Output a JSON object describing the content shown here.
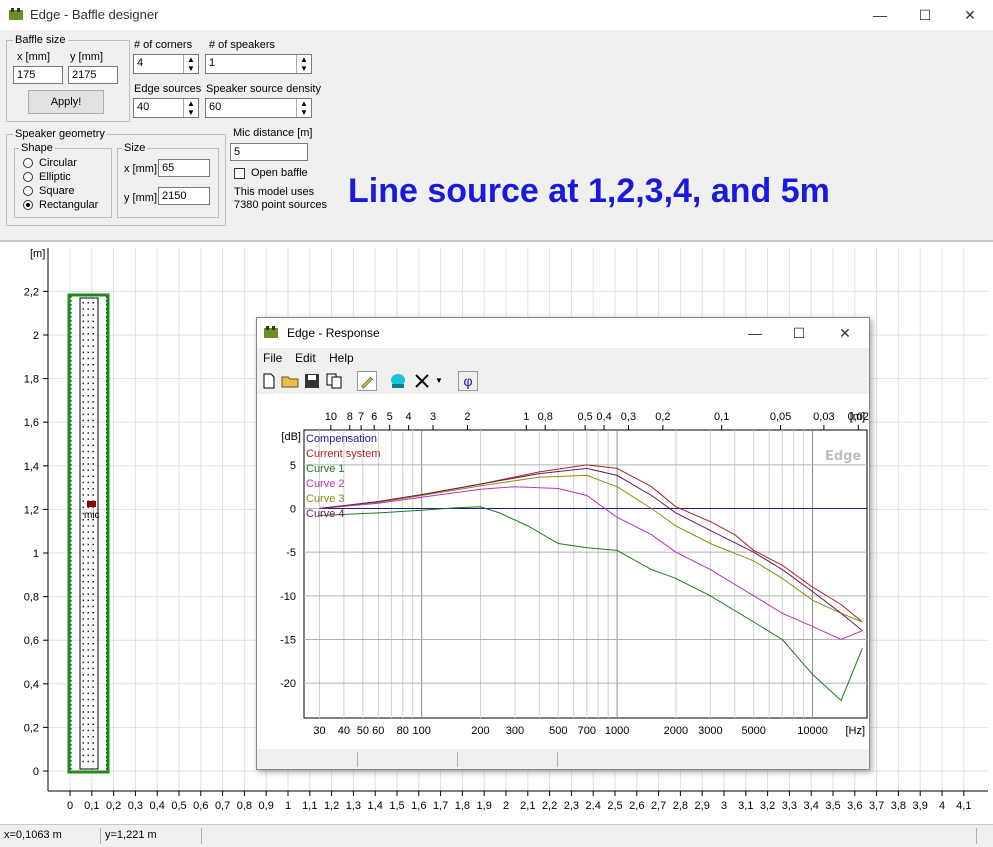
{
  "window": {
    "title": "Edge - Baffle designer",
    "minimize_glyph": "—",
    "maximize_glyph": "☐",
    "close_glyph": "✕"
  },
  "baffle_size": {
    "legend": "Baffle size",
    "x_label": "x [mm]",
    "y_label": "y [mm]",
    "x_value": "175",
    "y_value": "2175",
    "apply_label": "Apply!"
  },
  "corners": {
    "label": "# of corners",
    "value": "4"
  },
  "speakers": {
    "label": "# of speakers",
    "value": "1"
  },
  "edge_sources": {
    "label": "Edge sources",
    "value": "40"
  },
  "source_density": {
    "label": "Speaker source density",
    "value": "60"
  },
  "speaker_geometry": {
    "legend": "Speaker geometry",
    "shape_legend": "Shape",
    "shapes": [
      "Circular",
      "Elliptic",
      "Square",
      "Rectangular"
    ],
    "selected_shape": "Rectangular",
    "size_legend": "Size",
    "x_label": "x [mm]",
    "y_label": "y [mm]",
    "x_value": "65",
    "y_value": "2150"
  },
  "mic": {
    "label": "Mic distance [m]",
    "value": "5",
    "open_baffle_label": "Open baffle",
    "model_note_1": "This model uses",
    "model_note_2": "7380 point sources",
    "mic_marker_label": "mic"
  },
  "headline": "Line source at 1,2,3,4, and 5m",
  "plot": {
    "unit_label": "[m]",
    "y_ticks": [
      "0",
      "0,2",
      "0,4",
      "0,6",
      "0,8",
      "1",
      "1,2",
      "1,4",
      "1,6",
      "1,8",
      "2",
      "2,2"
    ],
    "x_ticks": [
      "0",
      "0,1",
      "0,2",
      "0,3",
      "0,4",
      "0,5",
      "0,6",
      "0,7",
      "0,8",
      "0,9",
      "1",
      "1,1",
      "1,2",
      "1,3",
      "1,4",
      "1,5",
      "1,6",
      "1,7",
      "1,8",
      "1,9",
      "2",
      "2,1",
      "2,2",
      "2,3",
      "2,4",
      "2,5",
      "2,6",
      "2,7",
      "2,8",
      "2,9",
      "3",
      "3,1",
      "3,2",
      "3,3",
      "3,4",
      "3,5",
      "3,6",
      "3,7",
      "3,8",
      "3,9",
      "4",
      "4,1"
    ]
  },
  "status": {
    "x": "x=0,1063 m",
    "y": "y=1,221 m"
  },
  "response_window": {
    "title": "Edge - Response",
    "menus": [
      "File",
      "Edit",
      "Help"
    ],
    "phase_button": "φ",
    "watermark": "Edge"
  },
  "colors": {
    "compensation": "#1f1f8f",
    "current_system": "#b22222",
    "curve1": "#1f7a1f",
    "curve2": "#c030c0",
    "curve3": "#8c8c14",
    "curve4": "#6b1a5a",
    "headline": "#1a1adc"
  },
  "chart_data": {
    "type": "line",
    "x_scale": "log",
    "xlabel": "[Hz]",
    "ylabel": "[dB]",
    "xlim": [
      25,
      19000
    ],
    "ylim": [
      -24,
      9
    ],
    "x_ticks": [
      30,
      40,
      50,
      60,
      80,
      100,
      200,
      300,
      500,
      700,
      1000,
      2000,
      3000,
      5000,
      10000
    ],
    "x_tick_labels": [
      "30",
      "40",
      "50",
      "60",
      "80",
      "100",
      "200",
      "300",
      "500",
      "700",
      "1000",
      "2000",
      "3000",
      "5000",
      "10000"
    ],
    "y_ticks": [
      5,
      0,
      -5,
      -10,
      -15,
      -20
    ],
    "y_tick_labels": [
      "5",
      "0",
      "-5",
      "-10",
      "-15",
      "-20"
    ],
    "top_axis_label": "[m]",
    "top_axis_ticks": [
      "10",
      "8",
      "7",
      "6",
      "5",
      "4",
      "3",
      "2",
      "1",
      "0,8",
      "0,5",
      "0,4",
      "0,3",
      "0,2",
      "0,1",
      "0,05",
      "0,03",
      "0,02"
    ],
    "top_axis_values": [
      10,
      8,
      7,
      6,
      5,
      4,
      3,
      2,
      1,
      0.8,
      0.5,
      0.4,
      0.3,
      0.2,
      0.1,
      0.05,
      0.03,
      0.02
    ],
    "grid": true,
    "legend": [
      "Compensation",
      "Current system",
      "Curve 1",
      "Curve 2",
      "Curve 3",
      "Curve 4"
    ],
    "series": [
      {
        "name": "Compensation",
        "points": [
          [
            30,
            0
          ],
          [
            19000,
            0
          ]
        ]
      },
      {
        "name": "Current system",
        "points": [
          [
            30,
            0
          ],
          [
            60,
            0.8
          ],
          [
            100,
            1.6
          ],
          [
            200,
            2.8
          ],
          [
            400,
            4.2
          ],
          [
            700,
            5
          ],
          [
            1000,
            4.6
          ],
          [
            1500,
            2.5
          ],
          [
            2000,
            0.2
          ],
          [
            3000,
            -1.5
          ],
          [
            4000,
            -3
          ],
          [
            5000,
            -4.8
          ],
          [
            7000,
            -6.5
          ],
          [
            10000,
            -9
          ],
          [
            14000,
            -11
          ],
          [
            18000,
            -13
          ]
        ]
      },
      {
        "name": "Curve 1",
        "points": [
          [
            30,
            -0.8
          ],
          [
            60,
            -0.5
          ],
          [
            100,
            -0.2
          ],
          [
            150,
            0.1
          ],
          [
            200,
            0.2
          ],
          [
            250,
            -0.5
          ],
          [
            350,
            -2
          ],
          [
            500,
            -4
          ],
          [
            700,
            -4.5
          ],
          [
            1000,
            -4.8
          ],
          [
            1500,
            -7
          ],
          [
            2000,
            -8
          ],
          [
            3000,
            -10
          ],
          [
            5000,
            -13
          ],
          [
            7000,
            -15
          ],
          [
            10000,
            -19
          ],
          [
            14000,
            -22
          ],
          [
            18000,
            -16
          ]
        ]
      },
      {
        "name": "Curve 2",
        "points": [
          [
            30,
            0
          ],
          [
            60,
            0.6
          ],
          [
            100,
            1.3
          ],
          [
            200,
            2.2
          ],
          [
            300,
            2.5
          ],
          [
            500,
            2.3
          ],
          [
            700,
            1.5
          ],
          [
            1000,
            -1
          ],
          [
            1500,
            -3
          ],
          [
            2000,
            -5
          ],
          [
            3000,
            -7
          ],
          [
            5000,
            -10
          ],
          [
            7000,
            -12
          ],
          [
            10000,
            -13.5
          ],
          [
            14000,
            -15
          ],
          [
            18000,
            -14
          ]
        ]
      },
      {
        "name": "Curve 3",
        "points": [
          [
            30,
            0
          ],
          [
            60,
            0.7
          ],
          [
            100,
            1.5
          ],
          [
            200,
            2.6
          ],
          [
            400,
            3.6
          ],
          [
            700,
            3.8
          ],
          [
            1000,
            2.5
          ],
          [
            1500,
            0
          ],
          [
            2000,
            -2
          ],
          [
            3000,
            -4
          ],
          [
            5000,
            -6
          ],
          [
            7000,
            -8
          ],
          [
            10000,
            -10.5
          ],
          [
            14000,
            -12
          ],
          [
            18000,
            -13
          ]
        ]
      },
      {
        "name": "Curve 4",
        "points": [
          [
            30,
            0
          ],
          [
            60,
            0.8
          ],
          [
            100,
            1.6
          ],
          [
            200,
            2.8
          ],
          [
            400,
            4
          ],
          [
            700,
            4.6
          ],
          [
            1000,
            3.8
          ],
          [
            1500,
            1.5
          ],
          [
            2000,
            -0.5
          ],
          [
            3000,
            -2.5
          ],
          [
            5000,
            -5
          ],
          [
            7000,
            -7
          ],
          [
            10000,
            -9.5
          ],
          [
            14000,
            -12
          ],
          [
            18000,
            -14
          ]
        ]
      }
    ]
  }
}
